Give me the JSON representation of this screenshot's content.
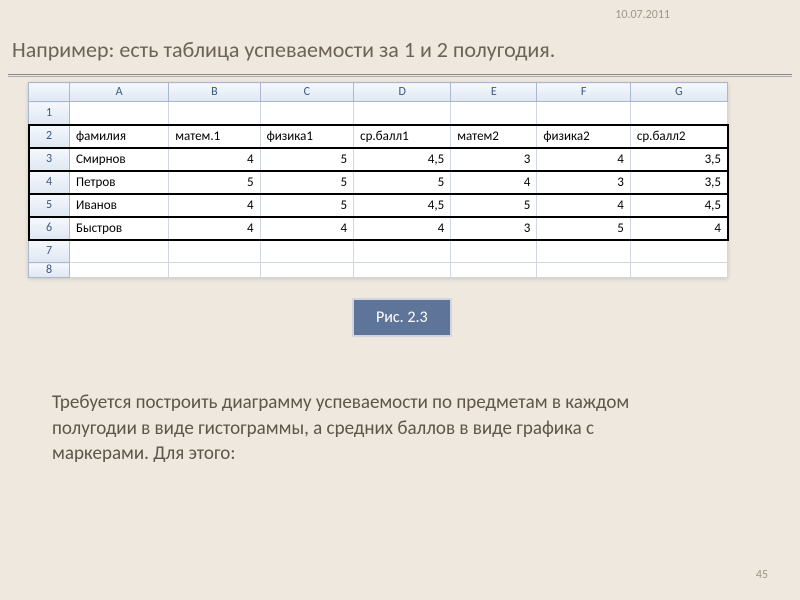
{
  "date": "10.07.2011",
  "title": "Например: есть таблица успеваемости за 1 и 2 полугодия.",
  "spreadsheet": {
    "columns": [
      "A",
      "B",
      "C",
      "D",
      "E",
      "F",
      "G"
    ],
    "rows": [
      {
        "n": "1",
        "cells": [
          "",
          "",
          "",
          "",
          "",
          "",
          ""
        ]
      },
      {
        "n": "2",
        "cells": [
          "фамилия",
          "матем.1",
          "физика1",
          "ср.балл1",
          "матем2",
          "физика2",
          "ср.балл2"
        ]
      },
      {
        "n": "3",
        "cells": [
          "Смирнов",
          "4",
          "5",
          "4,5",
          "3",
          "4",
          "3,5"
        ]
      },
      {
        "n": "4",
        "cells": [
          "Петров",
          "5",
          "5",
          "5",
          "4",
          "3",
          "3,5"
        ]
      },
      {
        "n": "5",
        "cells": [
          "Иванов",
          "4",
          "5",
          "4,5",
          "5",
          "4",
          "4,5"
        ]
      },
      {
        "n": "6",
        "cells": [
          "Быстров",
          "4",
          "4",
          "4",
          "3",
          "5",
          "4"
        ]
      },
      {
        "n": "7",
        "cells": [
          "",
          "",
          "",
          "",
          "",
          "",
          ""
        ]
      },
      {
        "n": "8",
        "cells": [
          "",
          "",
          "",
          "",
          "",
          "",
          ""
        ]
      }
    ]
  },
  "caption": "Рис. 2.3",
  "paragraph": "Требуется построить диаграмму успеваемости по предметам в каждом полугодии в виде гистограммы, а средних баллов в виде графика с маркерами. Для этого:",
  "page_number": "45",
  "chart_data": {
    "type": "table",
    "title": "Таблица успеваемости за 1 и 2 полугодия",
    "columns": [
      "фамилия",
      "матем.1",
      "физика1",
      "ср.балл1",
      "матем2",
      "физика2",
      "ср.балл2"
    ],
    "rows": [
      [
        "Смирнов",
        4,
        5,
        4.5,
        3,
        4,
        3.5
      ],
      [
        "Петров",
        5,
        5,
        5,
        4,
        3,
        3.5
      ],
      [
        "Иванов",
        4,
        5,
        4.5,
        5,
        4,
        4.5
      ],
      [
        "Быстров",
        4,
        4,
        4,
        3,
        5,
        4
      ]
    ]
  }
}
